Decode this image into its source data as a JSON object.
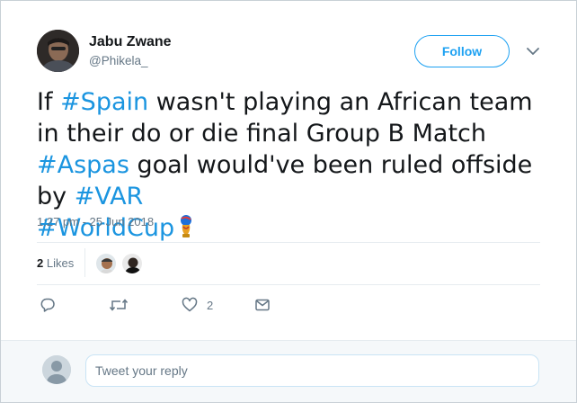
{
  "author": {
    "name": "Jabu Zwane",
    "handle": "@Phikela_"
  },
  "follow_label": "Follow",
  "tweet": {
    "t1": "If ",
    "h1": "#Spain",
    "t2": " wasn't playing an African team in their do or die final Group B Match ",
    "h2": "#Aspas",
    "t3": " goal would've been ruled offside by ",
    "h3": "#VAR",
    "h4": "#WorldCup"
  },
  "timestamp": "1:27 pm - 25 Jun 2018",
  "stats": {
    "likes_count": "2",
    "likes_label": "Likes"
  },
  "actions": {
    "like_count": "2"
  },
  "reply": {
    "placeholder": "Tweet your reply"
  },
  "colors": {
    "accent": "#1da1f2",
    "hashtag": "#1b95e0",
    "muted": "#657786"
  },
  "icons": [
    "chevron-down-icon",
    "world-cup-trophy-icon",
    "reply-icon",
    "retweet-icon",
    "heart-icon",
    "direct-message-icon"
  ]
}
